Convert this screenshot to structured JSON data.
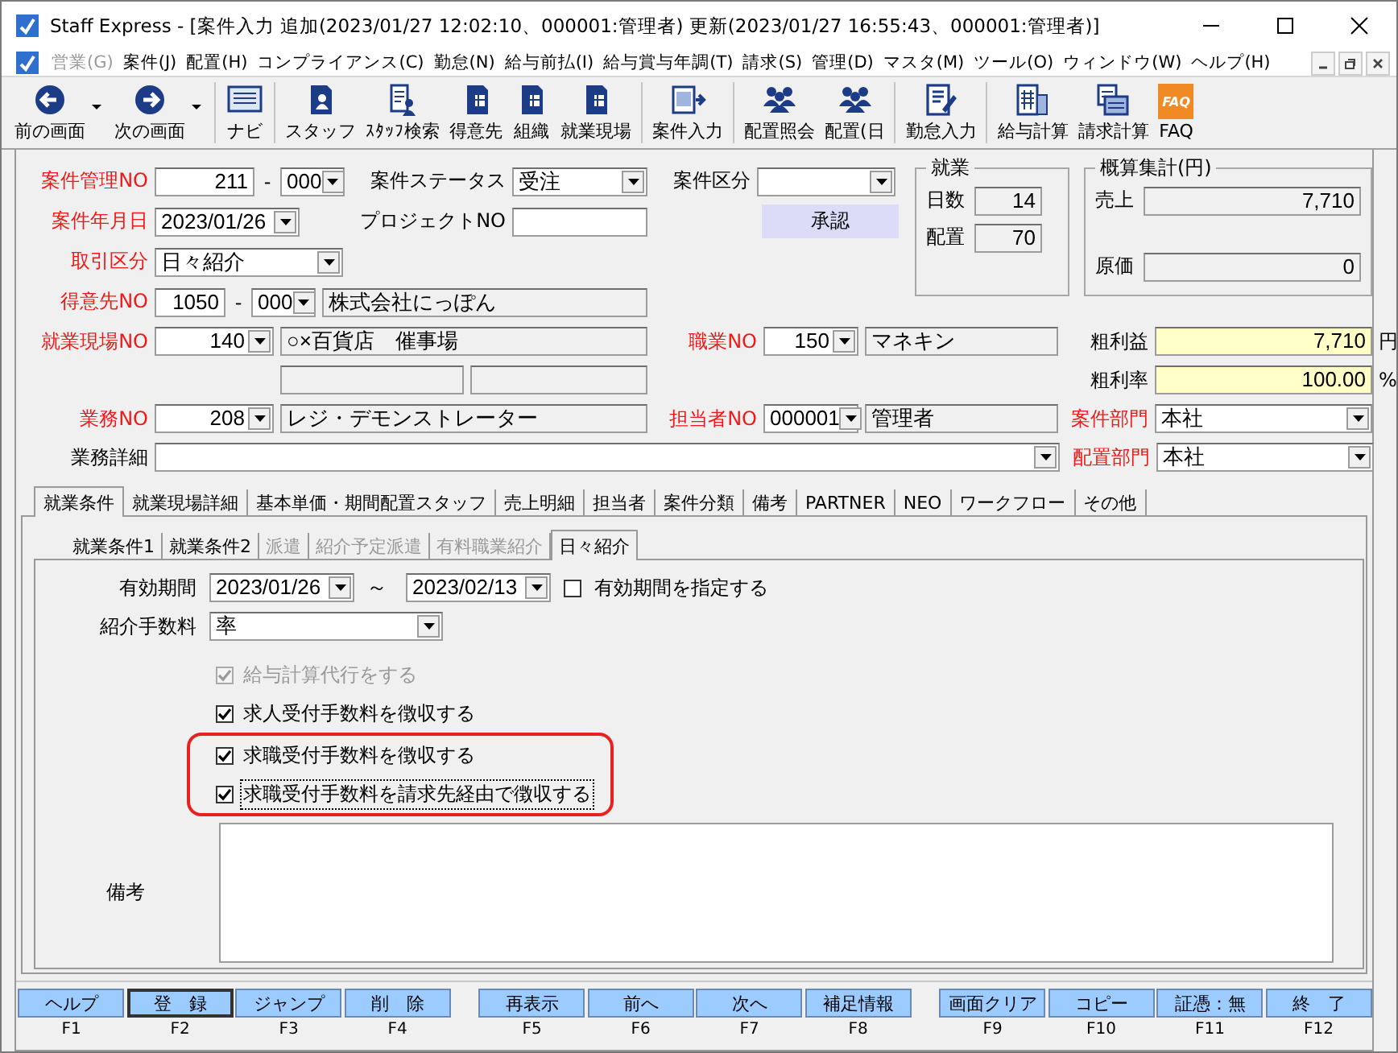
{
  "window": {
    "title": "Staff Express - [案件入力 追加(2023/01/27 12:02:10、000001:管理者) 更新(2023/01/27 16:55:43、000001:管理者)]"
  },
  "menu": [
    {
      "label": "営業(G)",
      "disabled": true
    },
    {
      "label": "案件(J)",
      "disabled": false
    },
    {
      "label": "配置(H)",
      "disabled": false
    },
    {
      "label": "コンプライアンス(C)",
      "disabled": false
    },
    {
      "label": "勤怠(N)",
      "disabled": false
    },
    {
      "label": "給与前払(I)",
      "disabled": false
    },
    {
      "label": "給与賞与年調(T)",
      "disabled": false
    },
    {
      "label": "請求(S)",
      "disabled": false
    },
    {
      "label": "管理(D)",
      "disabled": false
    },
    {
      "label": "マスタ(M)",
      "disabled": false
    },
    {
      "label": "ツール(O)",
      "disabled": false
    },
    {
      "label": "ウィンドウ(W)",
      "disabled": false
    },
    {
      "label": "ヘルプ(H)",
      "disabled": false
    }
  ],
  "toolbar": [
    [
      {
        "label": "前の画面",
        "dropdown": true
      },
      {
        "label": "次の画面",
        "dropdown": true
      }
    ],
    [
      {
        "label": "ナビ",
        "dropdown": false
      }
    ],
    [
      {
        "label": "スタッフ",
        "dropdown": false
      },
      {
        "label": "ｽﾀｯﾌ検索",
        "dropdown": false
      },
      {
        "label": "得意先",
        "dropdown": false
      },
      {
        "label": "組織",
        "dropdown": false
      },
      {
        "label": "就業現場",
        "dropdown": false
      }
    ],
    [
      {
        "label": "案件入力",
        "dropdown": false
      }
    ],
    [
      {
        "label": "配置照会",
        "dropdown": false
      },
      {
        "label": "配置(日",
        "dropdown": false
      }
    ],
    [
      {
        "label": "勤怠入力",
        "dropdown": false
      }
    ],
    [
      {
        "label": "給与計算",
        "dropdown": false
      },
      {
        "label": "請求計算",
        "dropdown": false
      },
      {
        "label": "FAQ",
        "dropdown": false,
        "icon_text": "FAQ"
      }
    ]
  ],
  "form": {
    "case_no": {
      "label": "案件管理NO",
      "required": true,
      "value": "211",
      "separator": "-",
      "branch": "000"
    },
    "case_status": {
      "label": "案件ステータス",
      "required": false,
      "value": "受注"
    },
    "case_category": {
      "label": "案件区分",
      "required": false
    },
    "approve_button": "承認",
    "case_date": {
      "label": "案件年月日",
      "required": true,
      "value": "2023/01/26"
    },
    "project_no": {
      "label": "プロジェクトNO",
      "required": false
    },
    "deal_type": {
      "label": "取引区分",
      "required": true,
      "value": "日々紹介"
    },
    "customer_no": {
      "label": "得意先NO",
      "required": true,
      "value": "1050",
      "separator": "-",
      "branch": "000",
      "name": "株式会社にっぽん"
    },
    "site_no": {
      "label": "就業現場NO",
      "required": true,
      "value": "140",
      "name": "○×百貨店　催事場"
    },
    "occupation_no": {
      "label": "職業NO",
      "required": true,
      "value": "150",
      "name": "マネキン"
    },
    "gross_profit": {
      "label": "粗利益",
      "value": "7,710",
      "unit": "円"
    },
    "gross_margin": {
      "label": "粗利率",
      "value": "100.00",
      "unit": "%"
    },
    "job_no": {
      "label": "業務NO",
      "required": true,
      "value": "208",
      "name": "レジ・デモンストレーター"
    },
    "staff_no": {
      "label": "担当者NO",
      "required": true,
      "value": "000001",
      "name": "管理者"
    },
    "case_dept": {
      "label": "案件部門",
      "required": true,
      "value": "本社"
    },
    "job_detail": {
      "label": "業務詳細",
      "required": false
    },
    "placement_dept": {
      "label": "配置部門",
      "required": true,
      "value": "本社"
    }
  },
  "work_group": {
    "title": "就業",
    "rows": [
      {
        "label": "日数",
        "value": "14"
      },
      {
        "label": "配置",
        "value": "70"
      }
    ]
  },
  "estimate_group": {
    "title": "概算集計(円)",
    "rows": [
      {
        "label": "売上",
        "value": "7,710"
      },
      {
        "label": "原価",
        "value": "0"
      }
    ]
  },
  "tabs": [
    {
      "label": "就業条件",
      "selected": true
    },
    {
      "label": "就業現場詳細",
      "selected": false
    },
    {
      "label": "基本単価・期間配置スタッフ",
      "selected": false
    },
    {
      "label": "売上明細",
      "selected": false
    },
    {
      "label": "担当者",
      "selected": false
    },
    {
      "label": "案件分類",
      "selected": false
    },
    {
      "label": "備考",
      "selected": false
    },
    {
      "label": "PARTNER",
      "selected": false
    },
    {
      "label": "NEO",
      "selected": false
    },
    {
      "label": "ワークフロー",
      "selected": false
    },
    {
      "label": "その他",
      "selected": false
    }
  ],
  "subtabs": [
    {
      "label": "就業条件1",
      "selected": false,
      "disabled": false
    },
    {
      "label": "就業条件2",
      "selected": false,
      "disabled": false
    },
    {
      "label": "派遣",
      "selected": false,
      "disabled": true
    },
    {
      "label": "紹介予定派遣",
      "selected": false,
      "disabled": true
    },
    {
      "label": "有料職業紹介",
      "selected": false,
      "disabled": true
    },
    {
      "label": "日々紹介",
      "selected": true,
      "disabled": false
    }
  ],
  "panel": {
    "period": {
      "label": "有効期間",
      "from": "2023/01/26",
      "separator": "～",
      "to": "2023/02/13",
      "check": {
        "label": "有効期間を指定する",
        "checked": false
      }
    },
    "fee": {
      "label": "紹介手数料",
      "value": "率"
    },
    "options": [
      {
        "label": "給与計算代行をする",
        "checked": true,
        "disabled": true,
        "highlighted": false,
        "focused": false
      },
      {
        "label": "求人受付手数料を徴収する",
        "checked": true,
        "disabled": false,
        "highlighted": false,
        "focused": false
      },
      {
        "label": "求職受付手数料を徴収する",
        "checked": true,
        "disabled": false,
        "highlighted": true,
        "focused": false
      },
      {
        "label": "求職受付手数料を請求先経由で徴収する",
        "checked": true,
        "disabled": false,
        "highlighted": true,
        "focused": true
      }
    ],
    "remarks": {
      "label": "備考"
    }
  },
  "function_keys": [
    {
      "label": "ヘルプ",
      "key": "F1",
      "default": false
    },
    {
      "label": "登　録",
      "key": "F2",
      "default": true
    },
    {
      "label": "ジャンプ",
      "key": "F3",
      "default": false
    },
    {
      "label": "削　除",
      "key": "F4",
      "default": false
    },
    {
      "label": "再表示",
      "key": "F5",
      "default": false
    },
    {
      "label": "前へ",
      "key": "F6",
      "default": false
    },
    {
      "label": "次へ",
      "key": "F7",
      "default": false
    },
    {
      "label": "補足情報",
      "key": "F8",
      "default": false
    },
    {
      "label": "画面クリア",
      "key": "F9",
      "default": false
    },
    {
      "label": "コピー",
      "key": "F10",
      "default": false
    },
    {
      "label": "証憑：無",
      "key": "F11",
      "default": false
    },
    {
      "label": "終　了",
      "key": "F12",
      "default": false
    }
  ]
}
